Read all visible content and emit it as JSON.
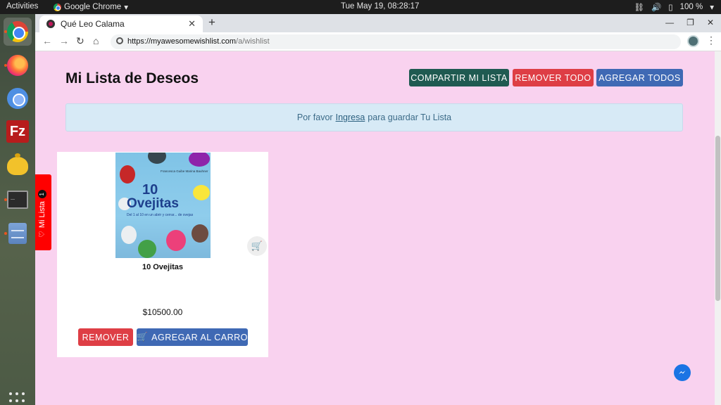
{
  "topbar": {
    "activities": "Activities",
    "app_menu": "Google Chrome",
    "clock": "Tue May 19, 08:28:17",
    "battery": "100 %"
  },
  "dock": {
    "items": [
      "chrome-icon",
      "firefox-icon",
      "chromium-icon",
      "filezilla-icon",
      "teapot-icon",
      "terminal-icon",
      "files-icon"
    ],
    "filezilla_glyph": "Fz"
  },
  "browser": {
    "tab_title": "Qué Leo Calama",
    "url_host": "https://myawesomewishlist.com",
    "url_path": "/a/wishlist"
  },
  "page": {
    "title": "Mi Lista de Deseos",
    "buttons": {
      "share": "COMPARTIR MI LISTA",
      "remove_all": "REMOVER TODO",
      "add_all": "AGREGAR TODOS"
    },
    "notice": {
      "before": "Por favor",
      "link": "Ingresa",
      "after": "para guardar Tu Lista"
    },
    "product": {
      "name": "10 Ovejitas",
      "price": "$10500.00",
      "cover_title_1": "10",
      "cover_title_2": "Ovejitas",
      "cover_subtitle": "Del 1 al 10 en un abrir y cerrar... de ovejas",
      "cover_authors": "Francesca Guibe  Marina Bauhner",
      "remove_label": "REMOVER",
      "add_cart_label": "AGREGAR AL CARRO"
    },
    "side_tab": {
      "label": "Mi Lista",
      "count": "1"
    }
  },
  "colors": {
    "page_bg": "#f9d2ef",
    "share": "#1f5a51",
    "danger": "#de3e45",
    "primary": "#3f69b4",
    "side_tab": "#ff0000"
  }
}
